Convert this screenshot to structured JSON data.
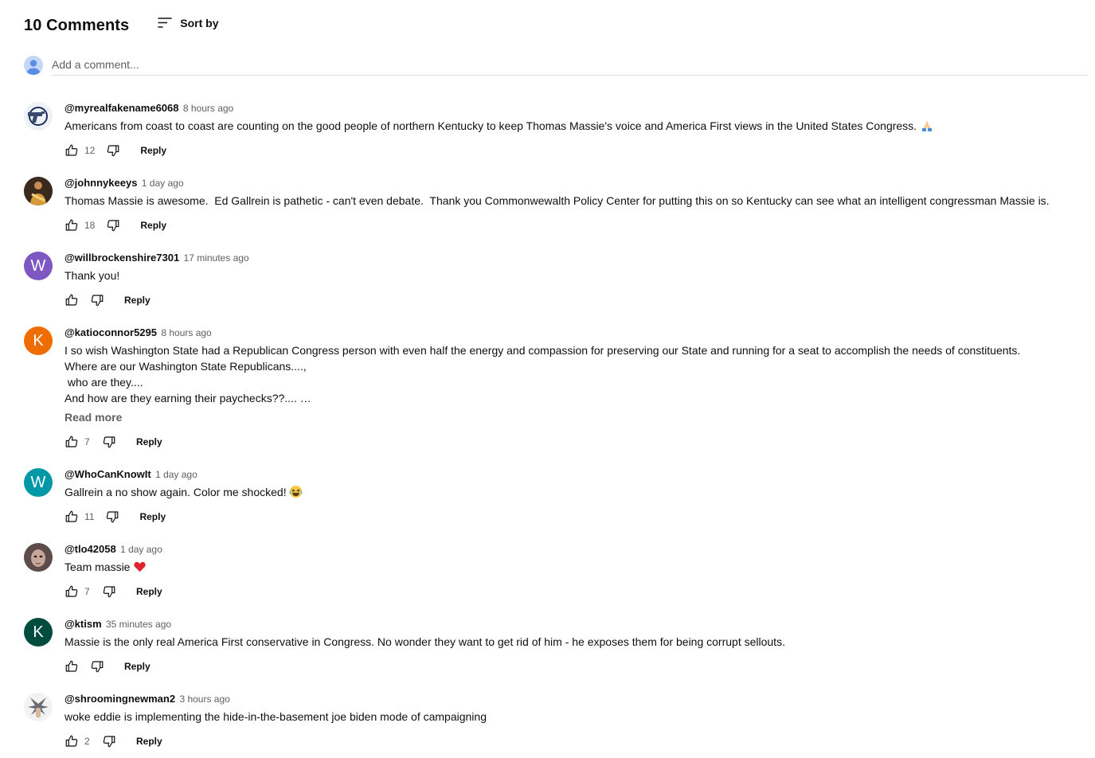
{
  "header": {
    "count_label": "10 Comments",
    "sort_label": "Sort by",
    "sort_icon": "sort-icon"
  },
  "add_comment": {
    "placeholder": "Add a comment..."
  },
  "reply_label": "Reply",
  "read_more_label": "Read more",
  "colors": {
    "avatar_w_purple": "#7e57c2",
    "avatar_k_orange": "#ef6c00",
    "avatar_w_teal": "#0097a7",
    "avatar_k_green": "#004d40"
  },
  "comments": [
    {
      "author": "@myrealfakename6068",
      "time": "8 hours ago",
      "text": "Americans from coast to coast are counting on the good people of northern Kentucky to keep Thomas Massie's voice and America First views in the United States Congress. ",
      "emoji": "folded-hands",
      "likes": "12"
    },
    {
      "author": "@johnnykeeys",
      "time": "1 day ago",
      "text": "Thomas Massie is awesome.  Ed Gallrein is pathetic - can't even debate.  Thank you Commonwewalth Policy Center for putting this on so Kentucky can see what an intelligent congressman Massie is.",
      "likes": "18"
    },
    {
      "author": "@willbrockenshire7301",
      "time": "17 minutes ago",
      "text": "Thank you!",
      "likes": "",
      "avatar_letter": "W"
    },
    {
      "author": "@katioconnor5295",
      "time": "8 hours ago",
      "text": "I so wish Washington State had a Republican Congress person with even half the energy and compassion for preserving our State and running for a seat to accomplish the needs of constituents.\nWhere are our Washington State Republicans....,\n who are they....\nAnd how are they earning their paychecks??.... …",
      "likes": "7",
      "avatar_letter": "K"
    },
    {
      "author": "@WhoCanKnowIt",
      "time": "1 day ago",
      "text": "Gallrein a no show again. Color me shocked! ",
      "emoji": "laughing-face",
      "likes": "11",
      "avatar_letter": "W"
    },
    {
      "author": "@tlo42058",
      "time": "1 day ago",
      "text": "Team massie ",
      "emoji": "red-heart",
      "likes": "7"
    },
    {
      "author": "@ktism",
      "time": "35 minutes ago",
      "text": "Massie is the only real America First conservative in Congress. No wonder they want to get rid of him - he exposes them for being corrupt sellouts.",
      "likes": "",
      "avatar_letter": "K"
    },
    {
      "author": "@shroomingnewman2",
      "time": "3 hours ago",
      "text": "woke eddie is implementing the hide-in-the-basement joe biden mode of campaigning",
      "likes": "2"
    }
  ]
}
